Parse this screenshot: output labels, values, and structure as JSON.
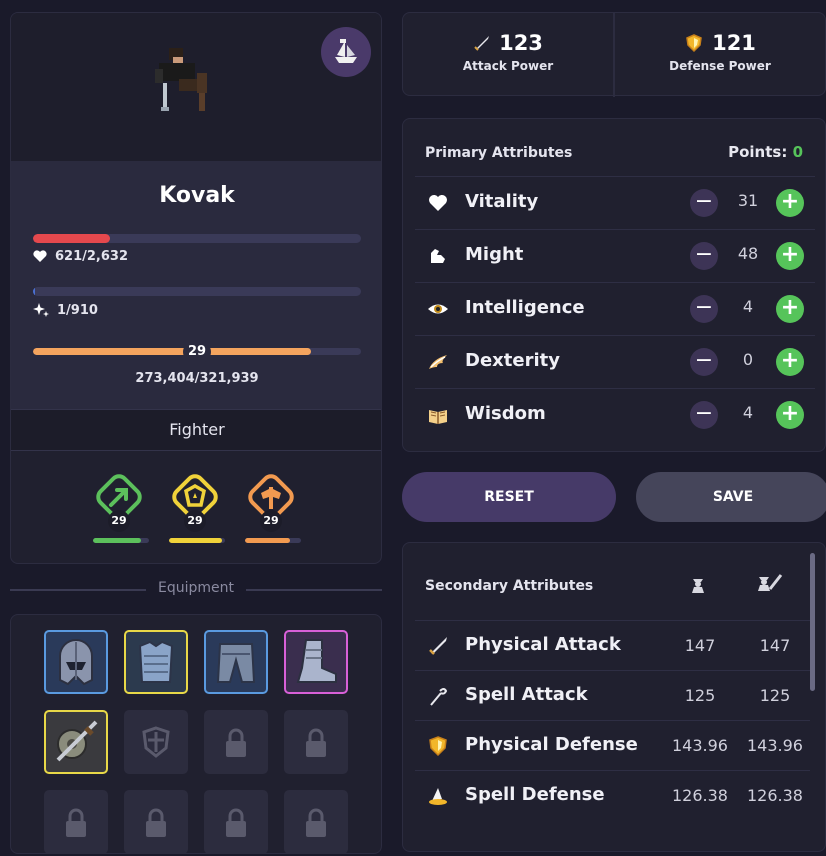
{
  "character": {
    "name": "Kovak",
    "class": "Fighter",
    "hp_text": "621/2,632",
    "hp_fraction": 0.236,
    "mp_text": "1/910",
    "mp_fraction": 0.001,
    "level": "29",
    "xp_text": "273,404/321,939",
    "xp_fraction": 0.849
  },
  "skills": [
    {
      "icon": "arrow-skill-icon",
      "level": "29",
      "color": "#5cc05c",
      "progress": 0.85
    },
    {
      "icon": "shield-skill-icon",
      "level": "29",
      "color": "#f0d23a",
      "progress": 0.95
    },
    {
      "icon": "axe-skill-icon",
      "level": "29",
      "color": "#f29a50",
      "progress": 0.8
    }
  ],
  "equipment": {
    "title": "Equipment"
  },
  "power": {
    "attack_value": "123",
    "attack_label": "Attack Power",
    "defense_value": "121",
    "defense_label": "Defense Power"
  },
  "primary": {
    "title": "Primary Attributes",
    "points_label": "Points:",
    "points_value": "0",
    "attributes": [
      {
        "name": "Vitality",
        "value": "31",
        "icon": "heart-icon"
      },
      {
        "name": "Might",
        "value": "48",
        "icon": "muscle-icon"
      },
      {
        "name": "Intelligence",
        "value": "4",
        "icon": "eye-icon"
      },
      {
        "name": "Dexterity",
        "value": "0",
        "icon": "wing-icon"
      },
      {
        "name": "Wisdom",
        "value": "4",
        "icon": "book-icon"
      }
    ]
  },
  "buttons": {
    "reset": "RESET",
    "save": "SAVE"
  },
  "secondary": {
    "title": "Secondary Attributes",
    "rows": [
      {
        "name": "Physical Attack",
        "base": "147",
        "total": "147",
        "icon": "sword-icon"
      },
      {
        "name": "Spell Attack",
        "base": "125",
        "total": "125",
        "icon": "staff-icon"
      },
      {
        "name": "Physical Defense",
        "base": "143.96",
        "total": "143.96",
        "icon": "shield-icon"
      },
      {
        "name": "Spell Defense",
        "base": "126.38",
        "total": "126.38",
        "icon": "hat-icon"
      }
    ]
  },
  "colors": {
    "hp": "#e5484d",
    "mp": "#4a6fd0",
    "xp": "#f4a45e",
    "accent_green": "#56c45a",
    "reset_button": "#463a68",
    "save_button": "#45455a"
  }
}
